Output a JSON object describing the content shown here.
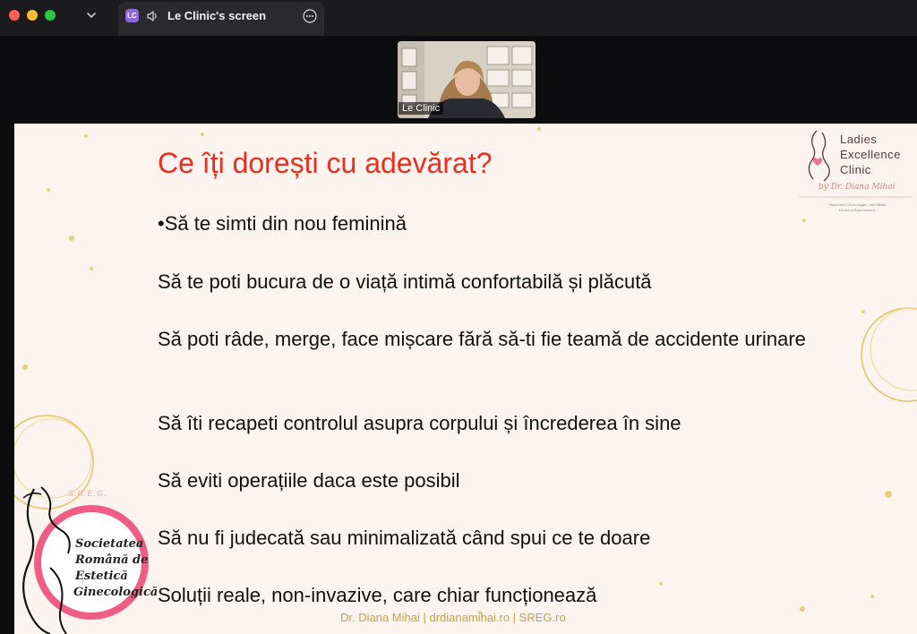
{
  "window": {
    "tab_badge": "LC",
    "tab_title": "Le Clinic's screen"
  },
  "video": {
    "participant_name": "Le Clinic"
  },
  "slide": {
    "title": "Ce îți dorești cu adevărat?",
    "bullets": [
      "•Să te simti din nou feminină",
      "Să te poti bucura de o viață intimă confortabilă și plăcută",
      "Să poti râde, merge, face mișcare fără să-ti fie teamă de accidente urinare",
      "Să îti recapeti controlul asupra corpului și încrederea în sine",
      "Să eviti operațiile daca este posibil",
      "Să nu fi judecată sau minimalizată când spui ce te doare",
      "Soluții reale, non-invazive, care chiar funcționează"
    ],
    "footer": "Dr. Diana Mihai | drdianamihai.ro | SREG.ro",
    "colors": {
      "title": "#ea2f1e",
      "background": "#fdf3ef",
      "footer": "#c5a24a"
    }
  },
  "logo_clinic": {
    "line1": "Ladies",
    "line2": "Excellence",
    "line3": "Clinic",
    "byline": "by Dr. Diana Mihai",
    "tagline": "Obstetrica | Ginecologie | Infertilitate Medicina Reproductiva"
  },
  "logo_sreg": {
    "abbr": "S.R.E.G.",
    "line1": "Societatea",
    "line2": "Română de",
    "line3": "Estetică",
    "line4": "Ginecologică"
  },
  "icons": {
    "close": "close-icon",
    "minimize": "minimize-icon",
    "zoom": "zoom-icon",
    "chevron": "chevron-down-icon",
    "speaker": "speaker-icon",
    "more": "more-options-icon"
  }
}
